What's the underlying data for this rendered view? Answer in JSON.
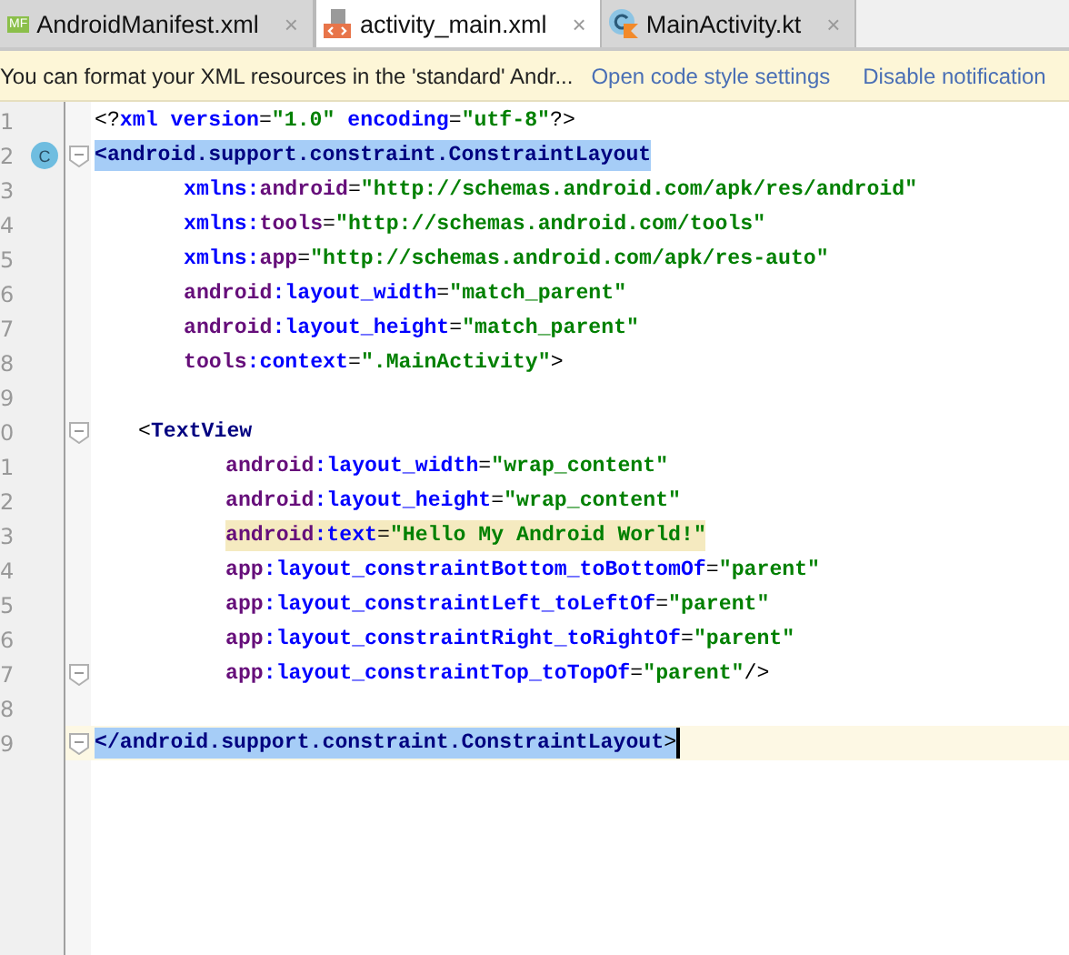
{
  "tabs": [
    {
      "label": "AndroidManifest.xml",
      "selected": false,
      "kind": "manifest",
      "icon_label": "MF",
      "close": "×"
    },
    {
      "label": "activity_main.xml",
      "selected": true,
      "kind": "xml",
      "close": "×"
    },
    {
      "label": "MainActivity.kt",
      "selected": false,
      "kind": "kotlin",
      "close": "×"
    }
  ],
  "notification": {
    "message": "You can format your XML resources in the 'standard' Andr...",
    "links": [
      "Open code style settings",
      "Disable notification"
    ]
  },
  "lines": [
    {
      "number": "1",
      "kind": "declaration",
      "fold": false,
      "current": false,
      "tokens": [
        {
          "kind": "punct",
          "text": "<?"
        },
        {
          "kind": "keyword",
          "text": "xml version"
        },
        {
          "kind": "punct",
          "text": "="
        },
        {
          "kind": "value",
          "text": "\"1.0\""
        },
        {
          "kind": "keyword",
          "text": " encoding"
        },
        {
          "kind": "punct",
          "text": "="
        },
        {
          "kind": "value",
          "text": "\"utf-8\""
        },
        {
          "kind": "punct",
          "text": "?>"
        }
      ]
    },
    {
      "number": "2",
      "kind": "root-tag",
      "badge": "C",
      "fold": true,
      "selected": true,
      "current": false,
      "tokens": [
        {
          "kind": "tag",
          "text": "<android.support.constraint.ConstraintLayout"
        }
      ]
    },
    {
      "number": "3",
      "kind": "root-attribute",
      "fold": false,
      "current": false,
      "tokens": [
        {
          "kind": "attr",
          "text": "xmlns:"
        },
        {
          "kind": "prefix",
          "text": "android"
        },
        {
          "kind": "punct",
          "text": "="
        },
        {
          "kind": "value",
          "text": "\"http://schemas.android.com/apk/res/android\""
        }
      ]
    },
    {
      "number": "4",
      "kind": "root-attribute",
      "fold": false,
      "current": false,
      "tokens": [
        {
          "kind": "attr",
          "text": "xmlns:"
        },
        {
          "kind": "prefix",
          "text": "tools"
        },
        {
          "kind": "punct",
          "text": "="
        },
        {
          "kind": "value",
          "text": "\"http://schemas.android.com/tools\""
        }
      ]
    },
    {
      "number": "5",
      "kind": "root-attribute",
      "fold": false,
      "current": false,
      "tokens": [
        {
          "kind": "attr",
          "text": "xmlns:"
        },
        {
          "kind": "prefix",
          "text": "app"
        },
        {
          "kind": "punct",
          "text": "="
        },
        {
          "kind": "value",
          "text": "\"http://schemas.android.com/apk/res-auto\""
        }
      ]
    },
    {
      "number": "6",
      "kind": "root-attribute",
      "fold": false,
      "current": false,
      "tokens": [
        {
          "kind": "prefix",
          "text": "android"
        },
        {
          "kind": "attr",
          "text": ":layout_width"
        },
        {
          "kind": "punct",
          "text": "="
        },
        {
          "kind": "value",
          "text": "\"match_parent\""
        }
      ]
    },
    {
      "number": "7",
      "kind": "root-attribute",
      "fold": false,
      "current": false,
      "tokens": [
        {
          "kind": "prefix",
          "text": "android"
        },
        {
          "kind": "attr",
          "text": ":layout_height"
        },
        {
          "kind": "punct",
          "text": "="
        },
        {
          "kind": "value",
          "text": "\"match_parent\""
        }
      ]
    },
    {
      "number": "8",
      "kind": "root-attribute",
      "fold": false,
      "current": false,
      "tokens": [
        {
          "kind": "prefix",
          "text": "tools"
        },
        {
          "kind": "attr",
          "text": ":context"
        },
        {
          "kind": "punct",
          "text": "="
        },
        {
          "kind": "value",
          "text": "\".MainActivity\""
        },
        {
          "kind": "punct",
          "text": ">"
        }
      ]
    },
    {
      "number": "9",
      "kind": "blank",
      "fold": false,
      "current": false
    },
    {
      "number": "0",
      "kind": "child-tag",
      "fold": true,
      "current": false,
      "tokens": [
        {
          "kind": "punct",
          "text": "<"
        },
        {
          "kind": "tag",
          "text": "TextView"
        }
      ]
    },
    {
      "number": "1",
      "kind": "child-attribute",
      "fold": false,
      "current": false,
      "tokens": [
        {
          "kind": "prefix",
          "text": "android"
        },
        {
          "kind": "attr",
          "text": ":layout_width"
        },
        {
          "kind": "punct",
          "text": "="
        },
        {
          "kind": "value",
          "text": "\"wrap_content\""
        }
      ]
    },
    {
      "number": "2",
      "kind": "child-attribute",
      "fold": false,
      "current": false,
      "tokens": [
        {
          "kind": "prefix",
          "text": "android"
        },
        {
          "kind": "attr",
          "text": ":layout_height"
        },
        {
          "kind": "punct",
          "text": "="
        },
        {
          "kind": "value",
          "text": "\"wrap_content\""
        }
      ]
    },
    {
      "number": "3",
      "kind": "child-attribute",
      "fold": false,
      "highlighted": true,
      "current": false,
      "tokens": [
        {
          "kind": "prefix",
          "text": "android"
        },
        {
          "kind": "attr",
          "text": ":text"
        },
        {
          "kind": "punct",
          "text": "="
        },
        {
          "kind": "value",
          "text": "\"Hello My Android World!\""
        }
      ]
    },
    {
      "number": "4",
      "kind": "child-attribute",
      "fold": false,
      "current": false,
      "tokens": [
        {
          "kind": "prefix",
          "text": "app"
        },
        {
          "kind": "attr",
          "text": ":layout_constraintBottom_toBottomOf"
        },
        {
          "kind": "punct",
          "text": "="
        },
        {
          "kind": "value",
          "text": "\"parent\""
        }
      ]
    },
    {
      "number": "5",
      "kind": "child-attribute",
      "fold": false,
      "current": false,
      "tokens": [
        {
          "kind": "prefix",
          "text": "app"
        },
        {
          "kind": "attr",
          "text": ":layout_constraintLeft_toLeftOf"
        },
        {
          "kind": "punct",
          "text": "="
        },
        {
          "kind": "value",
          "text": "\"parent\""
        }
      ]
    },
    {
      "number": "6",
      "kind": "child-attribute",
      "fold": false,
      "current": false,
      "tokens": [
        {
          "kind": "prefix",
          "text": "app"
        },
        {
          "kind": "attr",
          "text": ":layout_constraintRight_toRightOf"
        },
        {
          "kind": "punct",
          "text": "="
        },
        {
          "kind": "value",
          "text": "\"parent\""
        }
      ]
    },
    {
      "number": "7",
      "kind": "child-attribute",
      "fold": true,
      "current": false,
      "tokens": [
        {
          "kind": "prefix",
          "text": "app"
        },
        {
          "kind": "attr",
          "text": ":layout_constraintTop_toTopOf"
        },
        {
          "kind": "punct",
          "text": "="
        },
        {
          "kind": "value",
          "text": "\"parent\""
        },
        {
          "kind": "punct",
          "text": "/>"
        }
      ]
    },
    {
      "number": "8",
      "kind": "blank",
      "fold": false,
      "current": false
    },
    {
      "number": "9",
      "kind": "root-tag",
      "fold": true,
      "selected": true,
      "current": true,
      "tokens": [
        {
          "kind": "tag",
          "text": "</android.support.constraint.ConstraintLayout"
        },
        {
          "kind": "punct",
          "text": ">"
        }
      ]
    }
  ]
}
